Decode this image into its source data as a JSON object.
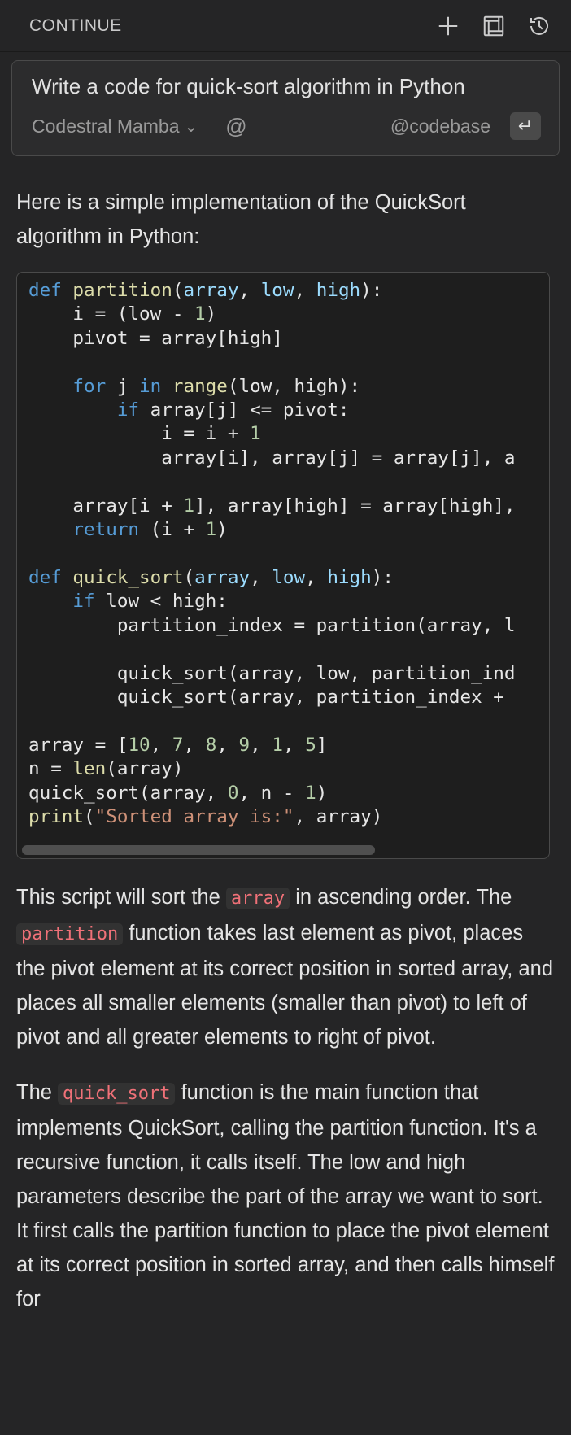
{
  "header": {
    "title": "CONTINUE",
    "icons": [
      "plus-icon",
      "maximize-icon",
      "history-icon"
    ]
  },
  "input": {
    "prompt": "Write a code for quick-sort algorithm in Python",
    "model": "Codestral Mamba",
    "mention_icon": "@",
    "context": "@codebase",
    "enter_icon": "↵"
  },
  "response": {
    "intro": "Here is a simple implementation of the QuickSort algorithm in Python:",
    "code_lines": [
      [
        {
          "t": "def",
          "c": "kw"
        },
        {
          "t": " "
        },
        {
          "t": "partition",
          "c": "fn"
        },
        {
          "t": "("
        },
        {
          "t": "array",
          "c": "pm"
        },
        {
          "t": ", "
        },
        {
          "t": "low",
          "c": "pm"
        },
        {
          "t": ", "
        },
        {
          "t": "high",
          "c": "pm"
        },
        {
          "t": "):"
        }
      ],
      [
        {
          "t": "    i = (low - "
        },
        {
          "t": "1",
          "c": "num"
        },
        {
          "t": ")"
        }
      ],
      [
        {
          "t": "    pivot = array[high]"
        }
      ],
      [],
      [
        {
          "t": "    "
        },
        {
          "t": "for",
          "c": "kw"
        },
        {
          "t": " j "
        },
        {
          "t": "in",
          "c": "kw"
        },
        {
          "t": " "
        },
        {
          "t": "range",
          "c": "fn"
        },
        {
          "t": "(low, high):"
        }
      ],
      [
        {
          "t": "        "
        },
        {
          "t": "if",
          "c": "kw"
        },
        {
          "t": " array[j] <= pivot:"
        }
      ],
      [
        {
          "t": "            i = i + "
        },
        {
          "t": "1",
          "c": "num"
        }
      ],
      [
        {
          "t": "            array[i], array[j] = array[j], a"
        }
      ],
      [],
      [
        {
          "t": "    array[i + "
        },
        {
          "t": "1",
          "c": "num"
        },
        {
          "t": "], array[high] = array[high],"
        }
      ],
      [
        {
          "t": "    "
        },
        {
          "t": "return",
          "c": "kw"
        },
        {
          "t": " (i + "
        },
        {
          "t": "1",
          "c": "num"
        },
        {
          "t": ")"
        }
      ],
      [],
      [
        {
          "t": "def",
          "c": "kw"
        },
        {
          "t": " "
        },
        {
          "t": "quick_sort",
          "c": "fn"
        },
        {
          "t": "("
        },
        {
          "t": "array",
          "c": "pm"
        },
        {
          "t": ", "
        },
        {
          "t": "low",
          "c": "pm"
        },
        {
          "t": ", "
        },
        {
          "t": "high",
          "c": "pm"
        },
        {
          "t": "):"
        }
      ],
      [
        {
          "t": "    "
        },
        {
          "t": "if",
          "c": "kw"
        },
        {
          "t": " low < high:"
        }
      ],
      [
        {
          "t": "        partition_index = partition(array, l"
        }
      ],
      [],
      [
        {
          "t": "        quick_sort(array, low, partition_ind"
        }
      ],
      [
        {
          "t": "        quick_sort(array, partition_index + "
        }
      ],
      [],
      [
        {
          "t": "array = ["
        },
        {
          "t": "10",
          "c": "num"
        },
        {
          "t": ", "
        },
        {
          "t": "7",
          "c": "num"
        },
        {
          "t": ", "
        },
        {
          "t": "8",
          "c": "num"
        },
        {
          "t": ", "
        },
        {
          "t": "9",
          "c": "num"
        },
        {
          "t": ", "
        },
        {
          "t": "1",
          "c": "num"
        },
        {
          "t": ", "
        },
        {
          "t": "5",
          "c": "num"
        },
        {
          "t": "]"
        }
      ],
      [
        {
          "t": "n = "
        },
        {
          "t": "len",
          "c": "fn"
        },
        {
          "t": "(array)"
        }
      ],
      [
        {
          "t": "quick_sort(array, "
        },
        {
          "t": "0",
          "c": "num"
        },
        {
          "t": ", n - "
        },
        {
          "t": "1",
          "c": "num"
        },
        {
          "t": ")"
        }
      ],
      [
        {
          "t": "print",
          "c": "fn"
        },
        {
          "t": "("
        },
        {
          "t": "\"Sorted array is:\"",
          "c": "str"
        },
        {
          "t": ", array)"
        }
      ]
    ],
    "para2": {
      "t1": "This script will sort the ",
      "c1": "array",
      "t2": " in ascending order. The ",
      "c2": "partition",
      "t3": " function takes last element as pivot, places the pivot element at its correct position in sorted array, and places all smaller elements (smaller than pivot) to left of pivot and all greater elements to right of pivot."
    },
    "para3": {
      "t1": "The ",
      "c1": "quick_sort",
      "t2": " function is the main function that implements QuickSort, calling the partition function. It's a recursive function, it calls itself. The low and high parameters describe the part of the array we want to sort. It first calls the partition function to place the pivot element at its correct position in sorted array, and then calls himself for"
    }
  }
}
